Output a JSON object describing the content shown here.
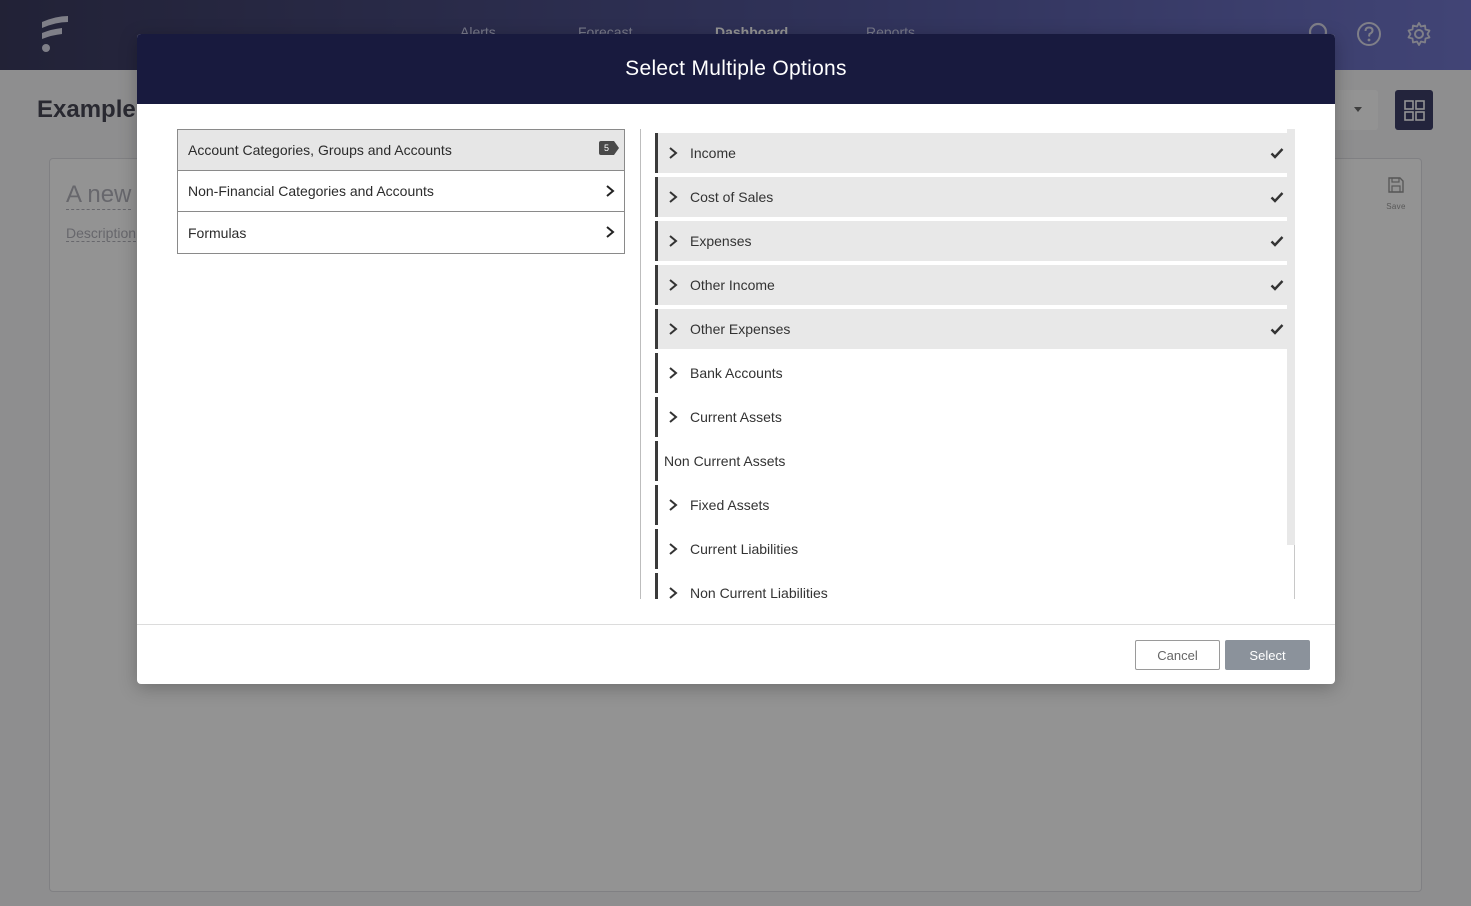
{
  "app": {
    "nav": [
      "Alerts",
      "Forecast",
      "Dashboard",
      "Reports"
    ],
    "active_nav": "Dashboard",
    "page_title": "Example",
    "card": {
      "title": "A new",
      "description": "Description",
      "save_label": "Save"
    }
  },
  "modal": {
    "title": "Select Multiple Options",
    "left_items": [
      {
        "label": "Account Categories, Groups and Accounts",
        "badge": "5"
      },
      {
        "label": "Non-Financial Categories and Accounts"
      },
      {
        "label": "Formulas"
      }
    ],
    "right_items": [
      {
        "label": "Income",
        "checked": true
      },
      {
        "label": "Cost of Sales",
        "checked": true
      },
      {
        "label": "Expenses",
        "checked": true
      },
      {
        "label": "Other Income",
        "checked": true
      },
      {
        "label": "Other Expenses",
        "checked": true
      },
      {
        "label": "Bank Accounts",
        "checked": false
      },
      {
        "label": "Current Assets",
        "checked": false
      },
      {
        "label": "Non Current Assets",
        "checked": false
      },
      {
        "label": "Fixed Assets",
        "checked": false
      },
      {
        "label": "Current Liabilities",
        "checked": false
      },
      {
        "label": "Non Current Liabilities",
        "checked": false
      }
    ],
    "cancel_label": "Cancel",
    "select_label": "Select"
  },
  "icons": {
    "logo": "logo-icon",
    "search": "search-icon",
    "help": "help-icon",
    "settings": "gear-icon",
    "grid": "grid-icon",
    "save": "save-icon",
    "chevron": "chevron-right-icon",
    "check": "check-icon"
  },
  "colors": {
    "header": "#181a3e",
    "selected_row": "#e8e8e8",
    "select_button": "#8b929b"
  }
}
